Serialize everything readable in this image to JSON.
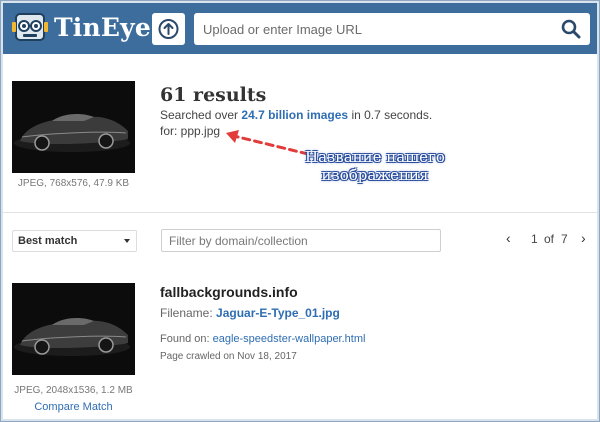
{
  "header": {
    "brand": "TinEye",
    "search_placeholder": "Upload or enter Image URL",
    "colors": {
      "bar": "#3c6d9d",
      "link": "#2f6db2"
    }
  },
  "query": {
    "results_count": "61 results",
    "searched_prefix": "Searched over ",
    "searched_strong": "24.7 billion images",
    "searched_suffix": " in 0.7 seconds.",
    "for_line": "for: ppp.jpg",
    "thumb_meta": "JPEG, 768x576, 47.9 KB",
    "annotation_line1": "Название нашего",
    "annotation_line2": "изображения"
  },
  "controls": {
    "sort_selected": "Best match",
    "filter_placeholder": "Filter by domain/collection",
    "page_current": "1",
    "page_of": "of",
    "page_total": "7"
  },
  "result": {
    "domain": "fallbackgrounds.info",
    "filename_label": "Filename: ",
    "filename_value": "Jaguar-E-Type_01.jpg",
    "found_label": "Found on: ",
    "found_value": "eagle-speedster-wallpaper.html",
    "crawled": "Page crawled on Nov 18, 2017",
    "thumb_meta": "JPEG, 2048x1536, 1.2 MB",
    "compare_label": "Compare Match"
  },
  "icons": [
    "tineye-robot-logo",
    "upload-arrow-icon",
    "search-icon",
    "chevron-left-icon",
    "chevron-right-icon",
    "caret-down-icon"
  ]
}
